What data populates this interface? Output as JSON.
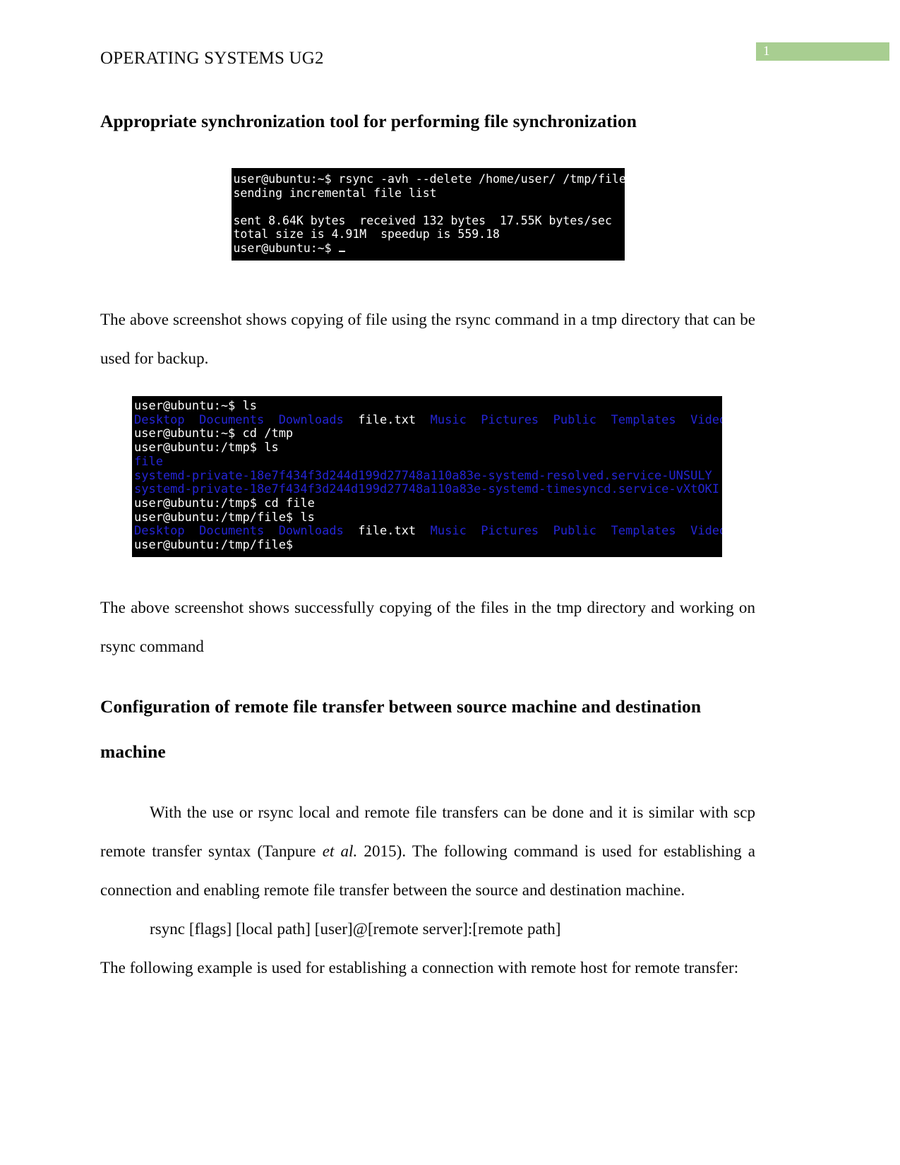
{
  "header": {
    "title": "OPERATING SYSTEMS UG2",
    "page_number": "1",
    "page_number_bg": "#a8ce91"
  },
  "headings": {
    "h1": "Appropriate synchronization tool for performing file synchronization",
    "h2": "Configuration of remote file transfer between source machine and destination machine"
  },
  "paragraphs": {
    "p1": "The above screenshot shows copying of file using the rsync command in a tmp directory that can be used for backup.",
    "p2": "The above screenshot shows successfully copying of the files in the tmp directory and working on rsync command",
    "p3_part1": "With the use or rsync local and remote file transfers can be done and it is similar with scp remote transfer syntax (Tanpure ",
    "p3_italic": "et al.",
    "p3_part2": " 2015). The following command is used for establishing a connection and enabling remote file transfer between the source and destination machine.",
    "p4_command": "rsync [flags] [local path] [user]@[remote server]:[remote path]",
    "p5": "The following example is used for establishing a connection with remote host for remote transfer:"
  },
  "terminal_1": {
    "colors": {
      "background": "#000000",
      "text": "#ffffff"
    },
    "lines": [
      "user@ubuntu:~$ rsync -avh --delete /home/user/ /tmp/file",
      "sending incremental file list",
      "",
      "sent 8.64K bytes  received 132 bytes  17.55K bytes/sec",
      "total size is 4.91M  speedup is 559.18",
      "user@ubuntu:~$ "
    ]
  },
  "terminal_2": {
    "colors": {
      "background": "#000000",
      "text": "#ffffff",
      "directory": "#2525d6"
    },
    "lines": [
      {
        "segments": [
          {
            "text": "user@ubuntu:~$ ls",
            "color": "white"
          }
        ]
      },
      {
        "segments": [
          {
            "text": "Desktop  Documents  Downloads",
            "color": "blue"
          },
          {
            "text": "  file.txt  ",
            "color": "white"
          },
          {
            "text": "Music  Pictures  Public  Templates  Videos",
            "color": "blue"
          }
        ]
      },
      {
        "segments": [
          {
            "text": "user@ubuntu:~$ cd /tmp",
            "color": "white"
          }
        ]
      },
      {
        "segments": [
          {
            "text": "user@ubuntu:/tmp$ ls",
            "color": "white"
          }
        ]
      },
      {
        "segments": [
          {
            "text": "file",
            "color": "blue"
          }
        ]
      },
      {
        "segments": [
          {
            "text": "systemd-private-18e7f434f3d244d199d27748a110a83e-systemd-resolved.service-UNSULY",
            "color": "blue"
          }
        ]
      },
      {
        "segments": [
          {
            "text": "systemd-private-18e7f434f3d244d199d27748a110a83e-systemd-timesyncd.service-vXtOKI",
            "color": "blue"
          }
        ]
      },
      {
        "segments": [
          {
            "text": "user@ubuntu:/tmp$ cd file",
            "color": "white"
          }
        ]
      },
      {
        "segments": [
          {
            "text": "user@ubuntu:/tmp/file$ ls",
            "color": "white"
          }
        ]
      },
      {
        "segments": [
          {
            "text": "Desktop  Documents  Downloads",
            "color": "blue"
          },
          {
            "text": "  file.txt  ",
            "color": "white"
          },
          {
            "text": "Music  Pictures  Public  Templates  Videos",
            "color": "blue"
          }
        ]
      },
      {
        "segments": [
          {
            "text": "user@ubuntu:/tmp/file$",
            "color": "white"
          }
        ]
      }
    ]
  }
}
